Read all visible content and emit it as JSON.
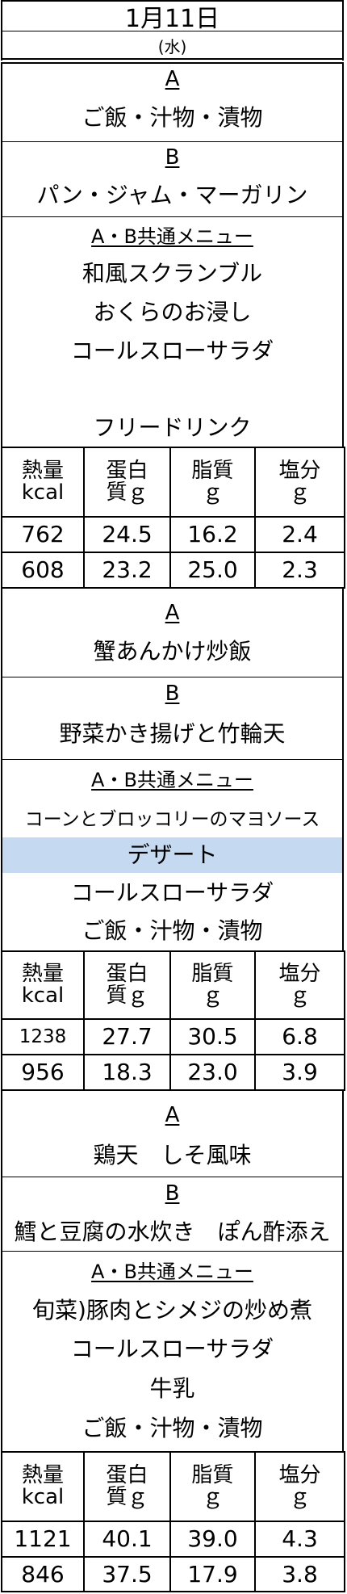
{
  "header": {
    "date": "1月11日",
    "weekday": "(水)"
  },
  "nutrition_headers": [
    [
      "熱量",
      "kcal"
    ],
    [
      "蛋白",
      "質ｇ"
    ],
    [
      "脂質",
      "ｇ"
    ],
    [
      "塩分",
      "ｇ"
    ]
  ],
  "meals": [
    {
      "a_label": "A",
      "a_items": [
        "ご飯・汁物・漬物"
      ],
      "b_label": "B",
      "b_items": [
        "パン・ジャム・マーガリン"
      ],
      "common_label": "A・B共通メニュー",
      "common_items": [
        "和風スクランブル",
        "おくらのお浸し",
        "コールスローサラダ",
        "",
        "フリードリンク"
      ],
      "values": [
        [
          "762",
          "24.5",
          "16.2",
          "2.4"
        ],
        [
          "608",
          "23.2",
          "25.0",
          "2.3"
        ]
      ]
    },
    {
      "a_label": "A",
      "a_items": [
        "蟹あんかけ炒飯"
      ],
      "b_label": "B",
      "b_items": [
        "野菜かき揚げと竹輪天"
      ],
      "common_label": "A・B共通メニュー",
      "common_items": [
        "コーンとブロッコリーのマヨソース",
        "デザート",
        "コールスローサラダ",
        "ご飯・汁物・漬物"
      ],
      "values": [
        [
          "1238",
          "27.7",
          "30.5",
          "6.8"
        ],
        [
          "956",
          "18.3",
          "23.0",
          "3.9"
        ]
      ]
    },
    {
      "a_label": "A",
      "a_items": [
        "鶏天　しそ風味"
      ],
      "b_label": "B",
      "b_items": [
        "鱈と豆腐の水炊き　ぽん酢添え"
      ],
      "common_label": "A・B共通メニュー",
      "common_items": [
        "旬菜)豚肉とシメジの炒め煮",
        "コールスローサラダ",
        "牛乳",
        "ご飯・汁物・漬物"
      ],
      "values": [
        [
          "1121",
          "40.1",
          "39.0",
          "4.3"
        ],
        [
          "846",
          "37.5",
          "17.9",
          "3.8"
        ]
      ]
    }
  ],
  "colors": {
    "highlight": "#c5d9f1",
    "border": "#000000"
  }
}
